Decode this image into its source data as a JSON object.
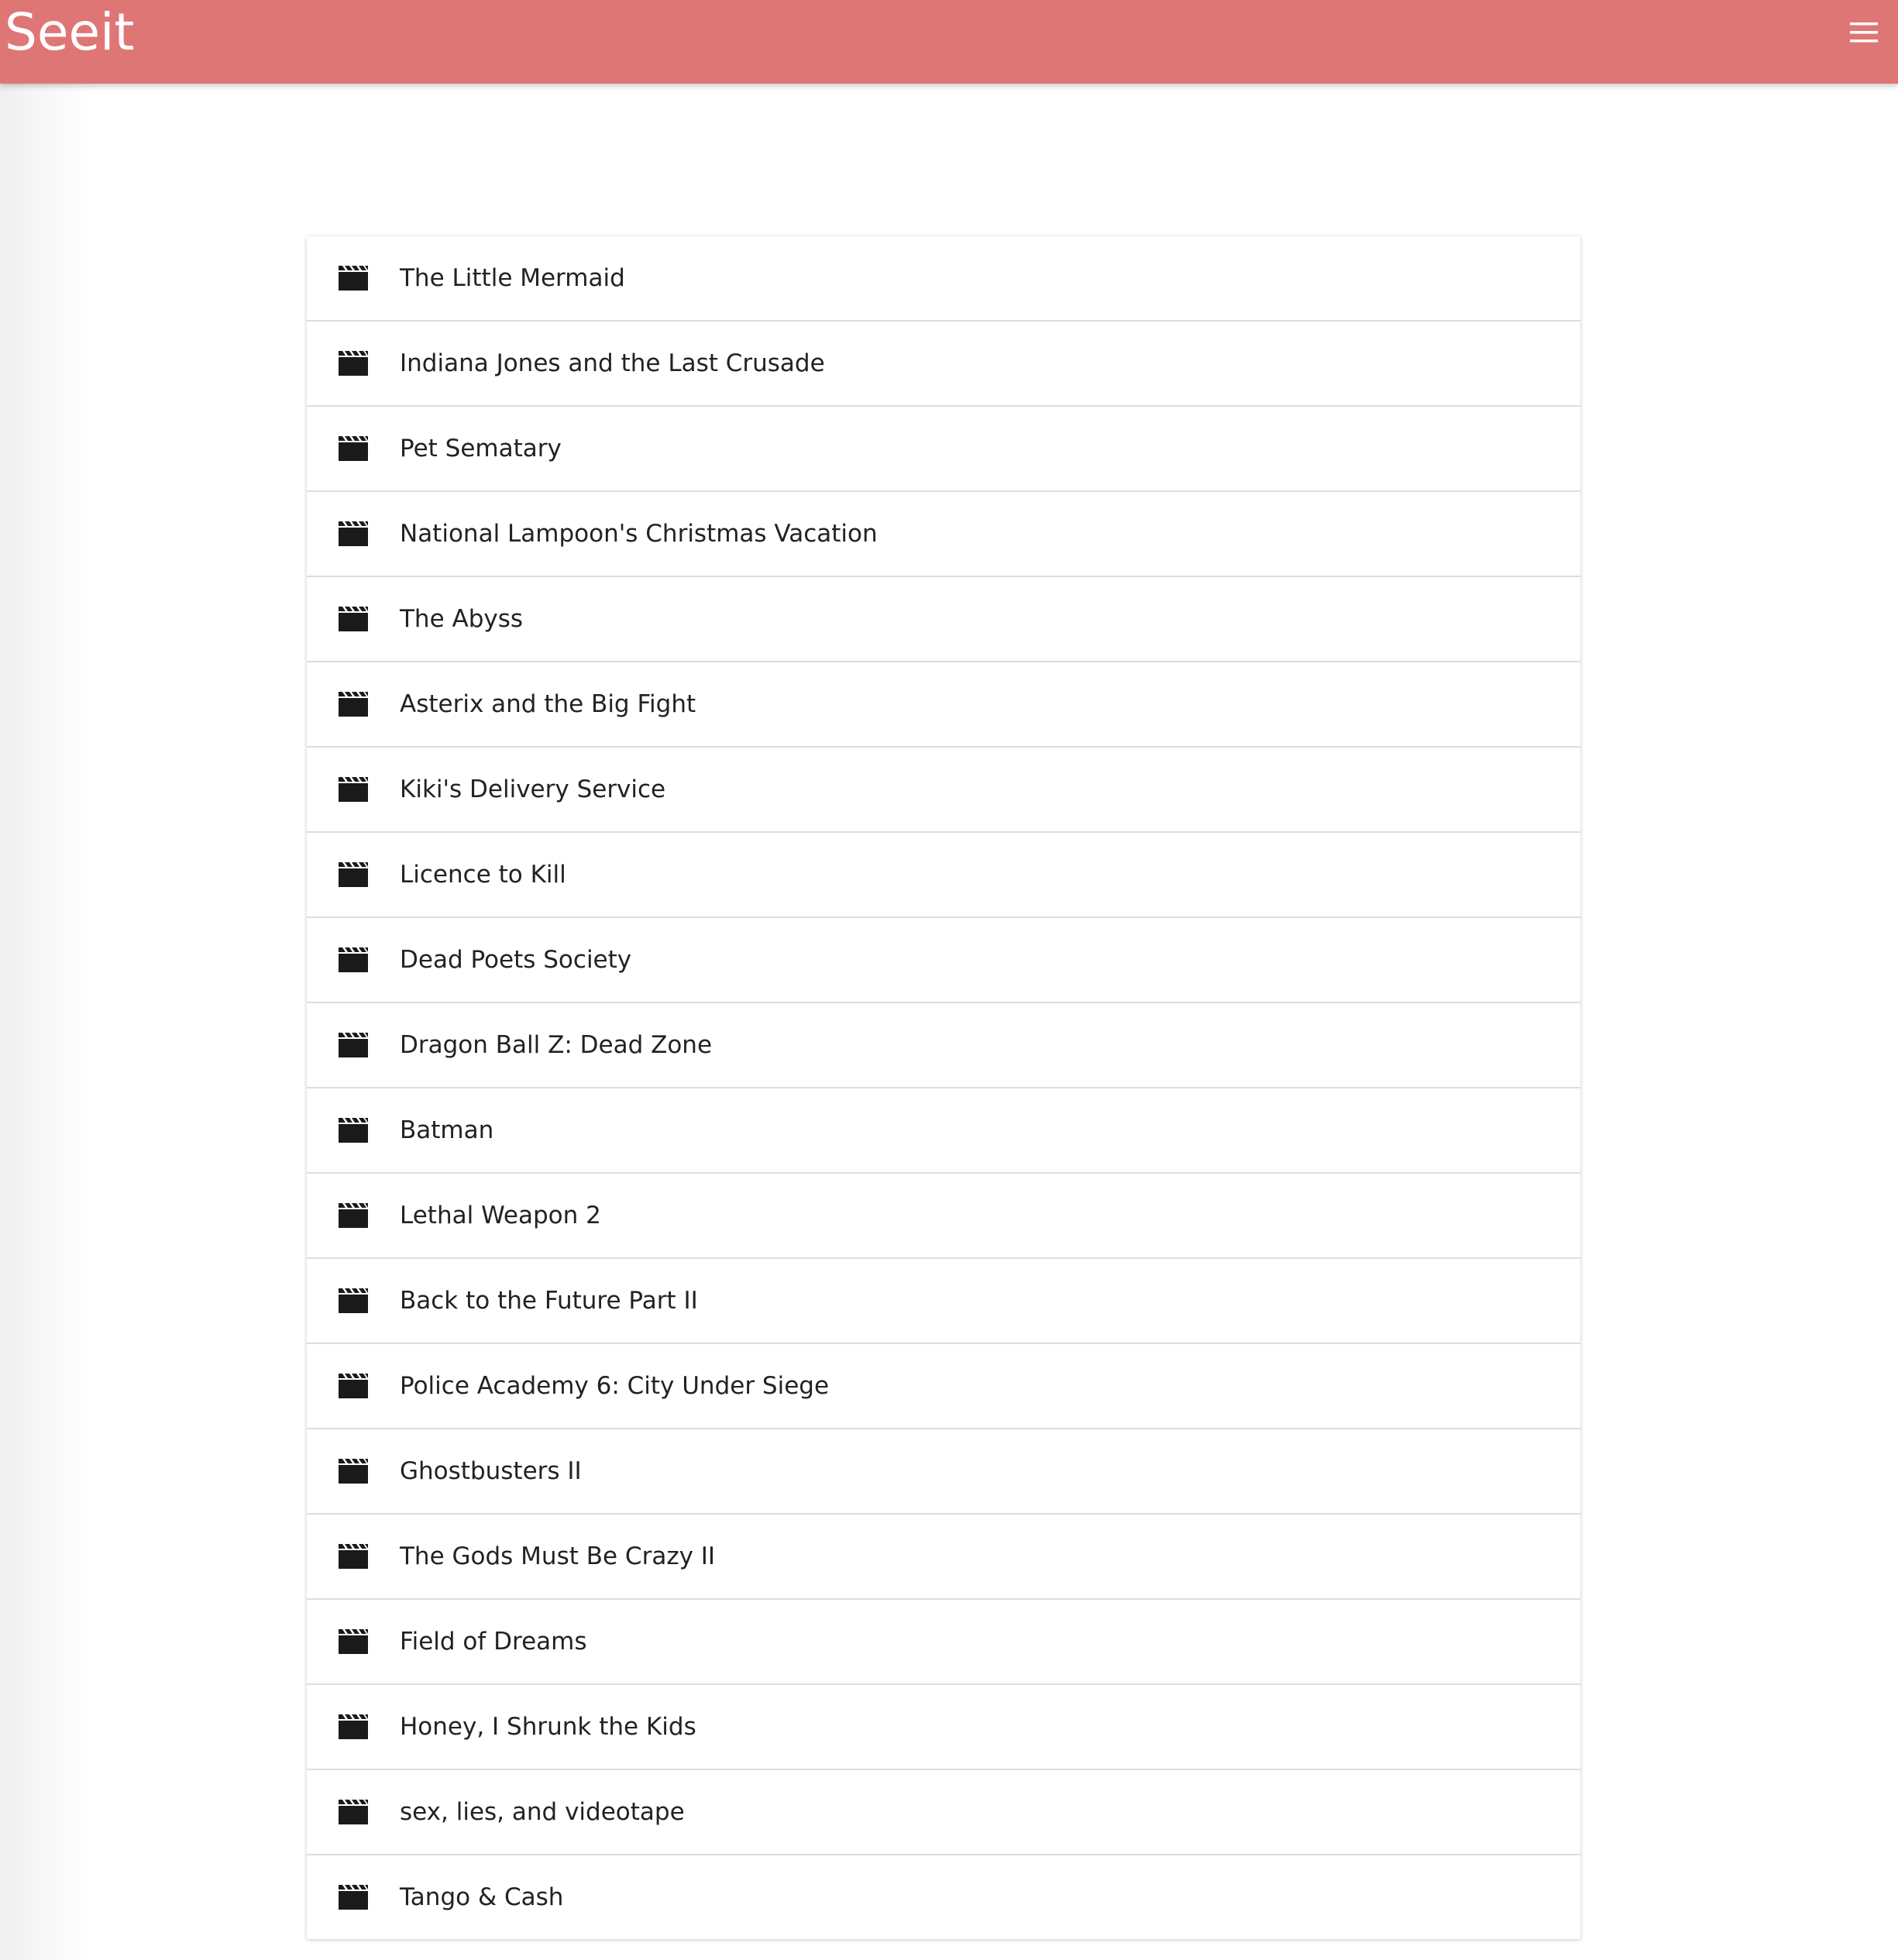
{
  "header": {
    "brand": "Seeit",
    "menu_icon": "hamburger-menu-icon",
    "background_color": "#df7676",
    "text_color": "#ffffff"
  },
  "movie_list": {
    "item_icon": "clapperboard-icon",
    "items": [
      {
        "title": "The Little Mermaid"
      },
      {
        "title": "Indiana Jones and the Last Crusade"
      },
      {
        "title": "Pet Sematary"
      },
      {
        "title": "National Lampoon's Christmas Vacation"
      },
      {
        "title": "The Abyss"
      },
      {
        "title": "Asterix and the Big Fight"
      },
      {
        "title": "Kiki's Delivery Service"
      },
      {
        "title": "Licence to Kill"
      },
      {
        "title": "Dead Poets Society"
      },
      {
        "title": "Dragon Ball Z: Dead Zone"
      },
      {
        "title": "Batman"
      },
      {
        "title": "Lethal Weapon 2"
      },
      {
        "title": "Back to the Future Part II"
      },
      {
        "title": "Police Academy 6: City Under Siege"
      },
      {
        "title": "Ghostbusters II"
      },
      {
        "title": "The Gods Must Be Crazy II"
      },
      {
        "title": "Field of Dreams"
      },
      {
        "title": "Honey, I Shrunk the Kids"
      },
      {
        "title": "sex, lies, and videotape"
      },
      {
        "title": "Tango & Cash"
      }
    ]
  }
}
